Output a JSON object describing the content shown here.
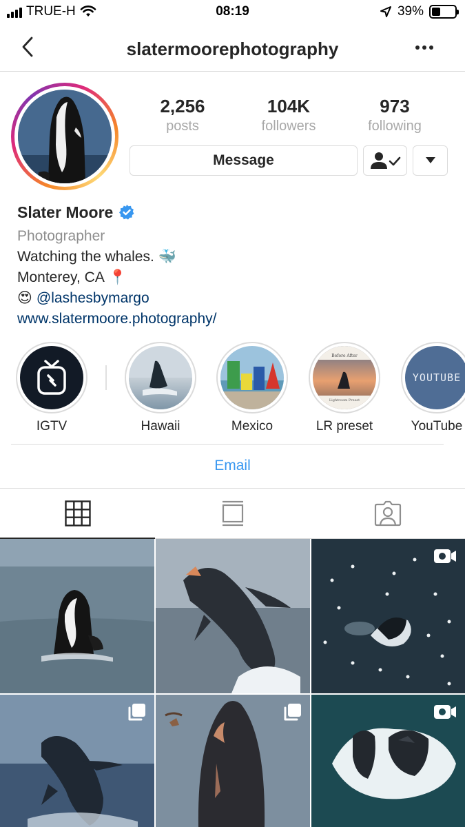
{
  "status_bar": {
    "carrier": "TRUE-H",
    "time": "08:19",
    "battery_percent": "39%",
    "battery_level": 0.39,
    "icons": [
      "signal-icon",
      "wifi-icon",
      "location-arrow-icon",
      "battery-icon"
    ]
  },
  "nav": {
    "username": "slatermoorephotography",
    "back_icon": "chevron-left-icon",
    "more_icon": "more-dots-icon"
  },
  "profile": {
    "stats": [
      {
        "value": "2,256",
        "label": "posts"
      },
      {
        "value": "104K",
        "label": "followers"
      },
      {
        "value": "973",
        "label": "following"
      }
    ],
    "actions": {
      "message_label": "Message",
      "following_icon": "following-check-icon",
      "dropdown_icon": "caret-down-icon"
    }
  },
  "bio": {
    "name": "Slater Moore",
    "verified_icon": "verified-badge-icon",
    "category": "Photographer",
    "line1": "Watching the whales.",
    "line1_emoji": "🐳",
    "line2": "Monterey, CA",
    "line2_emoji": "📍",
    "line3_emoji": "😍",
    "mention": "@lashesbymargo",
    "website": "www.slatermoore.photography/"
  },
  "highlights": [
    {
      "label": "IGTV",
      "icon": "igtv-icon"
    },
    {
      "label": "Hawaii"
    },
    {
      "label": "Mexico"
    },
    {
      "label": "LR preset",
      "cover_text_top": "Before After",
      "cover_text_bottom": "Lightroom Preset"
    },
    {
      "label": "YouTube",
      "cover_text": "YOUTUBE"
    }
  ],
  "contact": {
    "email_label": "Email"
  },
  "tabs": [
    {
      "name": "grid",
      "icon": "grid-icon",
      "active": true
    },
    {
      "name": "feed",
      "icon": "feed-icon",
      "active": false
    },
    {
      "name": "tagged",
      "icon": "tagged-person-icon",
      "active": false
    }
  ],
  "posts": [
    {
      "subject": "orca spyhop",
      "badge": ""
    },
    {
      "subject": "humpback breach",
      "badge": ""
    },
    {
      "subject": "aerial lunge feeding",
      "badge": "video-icon"
    },
    {
      "subject": "humpback breach",
      "badge": "multiple-icon"
    },
    {
      "subject": "humpback rostrum",
      "badge": "multiple-icon"
    },
    {
      "subject": "aerial group lunge",
      "badge": "video-icon"
    }
  ],
  "colors": {
    "text": "#262626",
    "secondary_text": "#8e8e8e",
    "link_blue": "#3897f0",
    "bio_link": "#003569",
    "border": "#dbdbdb",
    "verified_blue": "#3897f0"
  }
}
